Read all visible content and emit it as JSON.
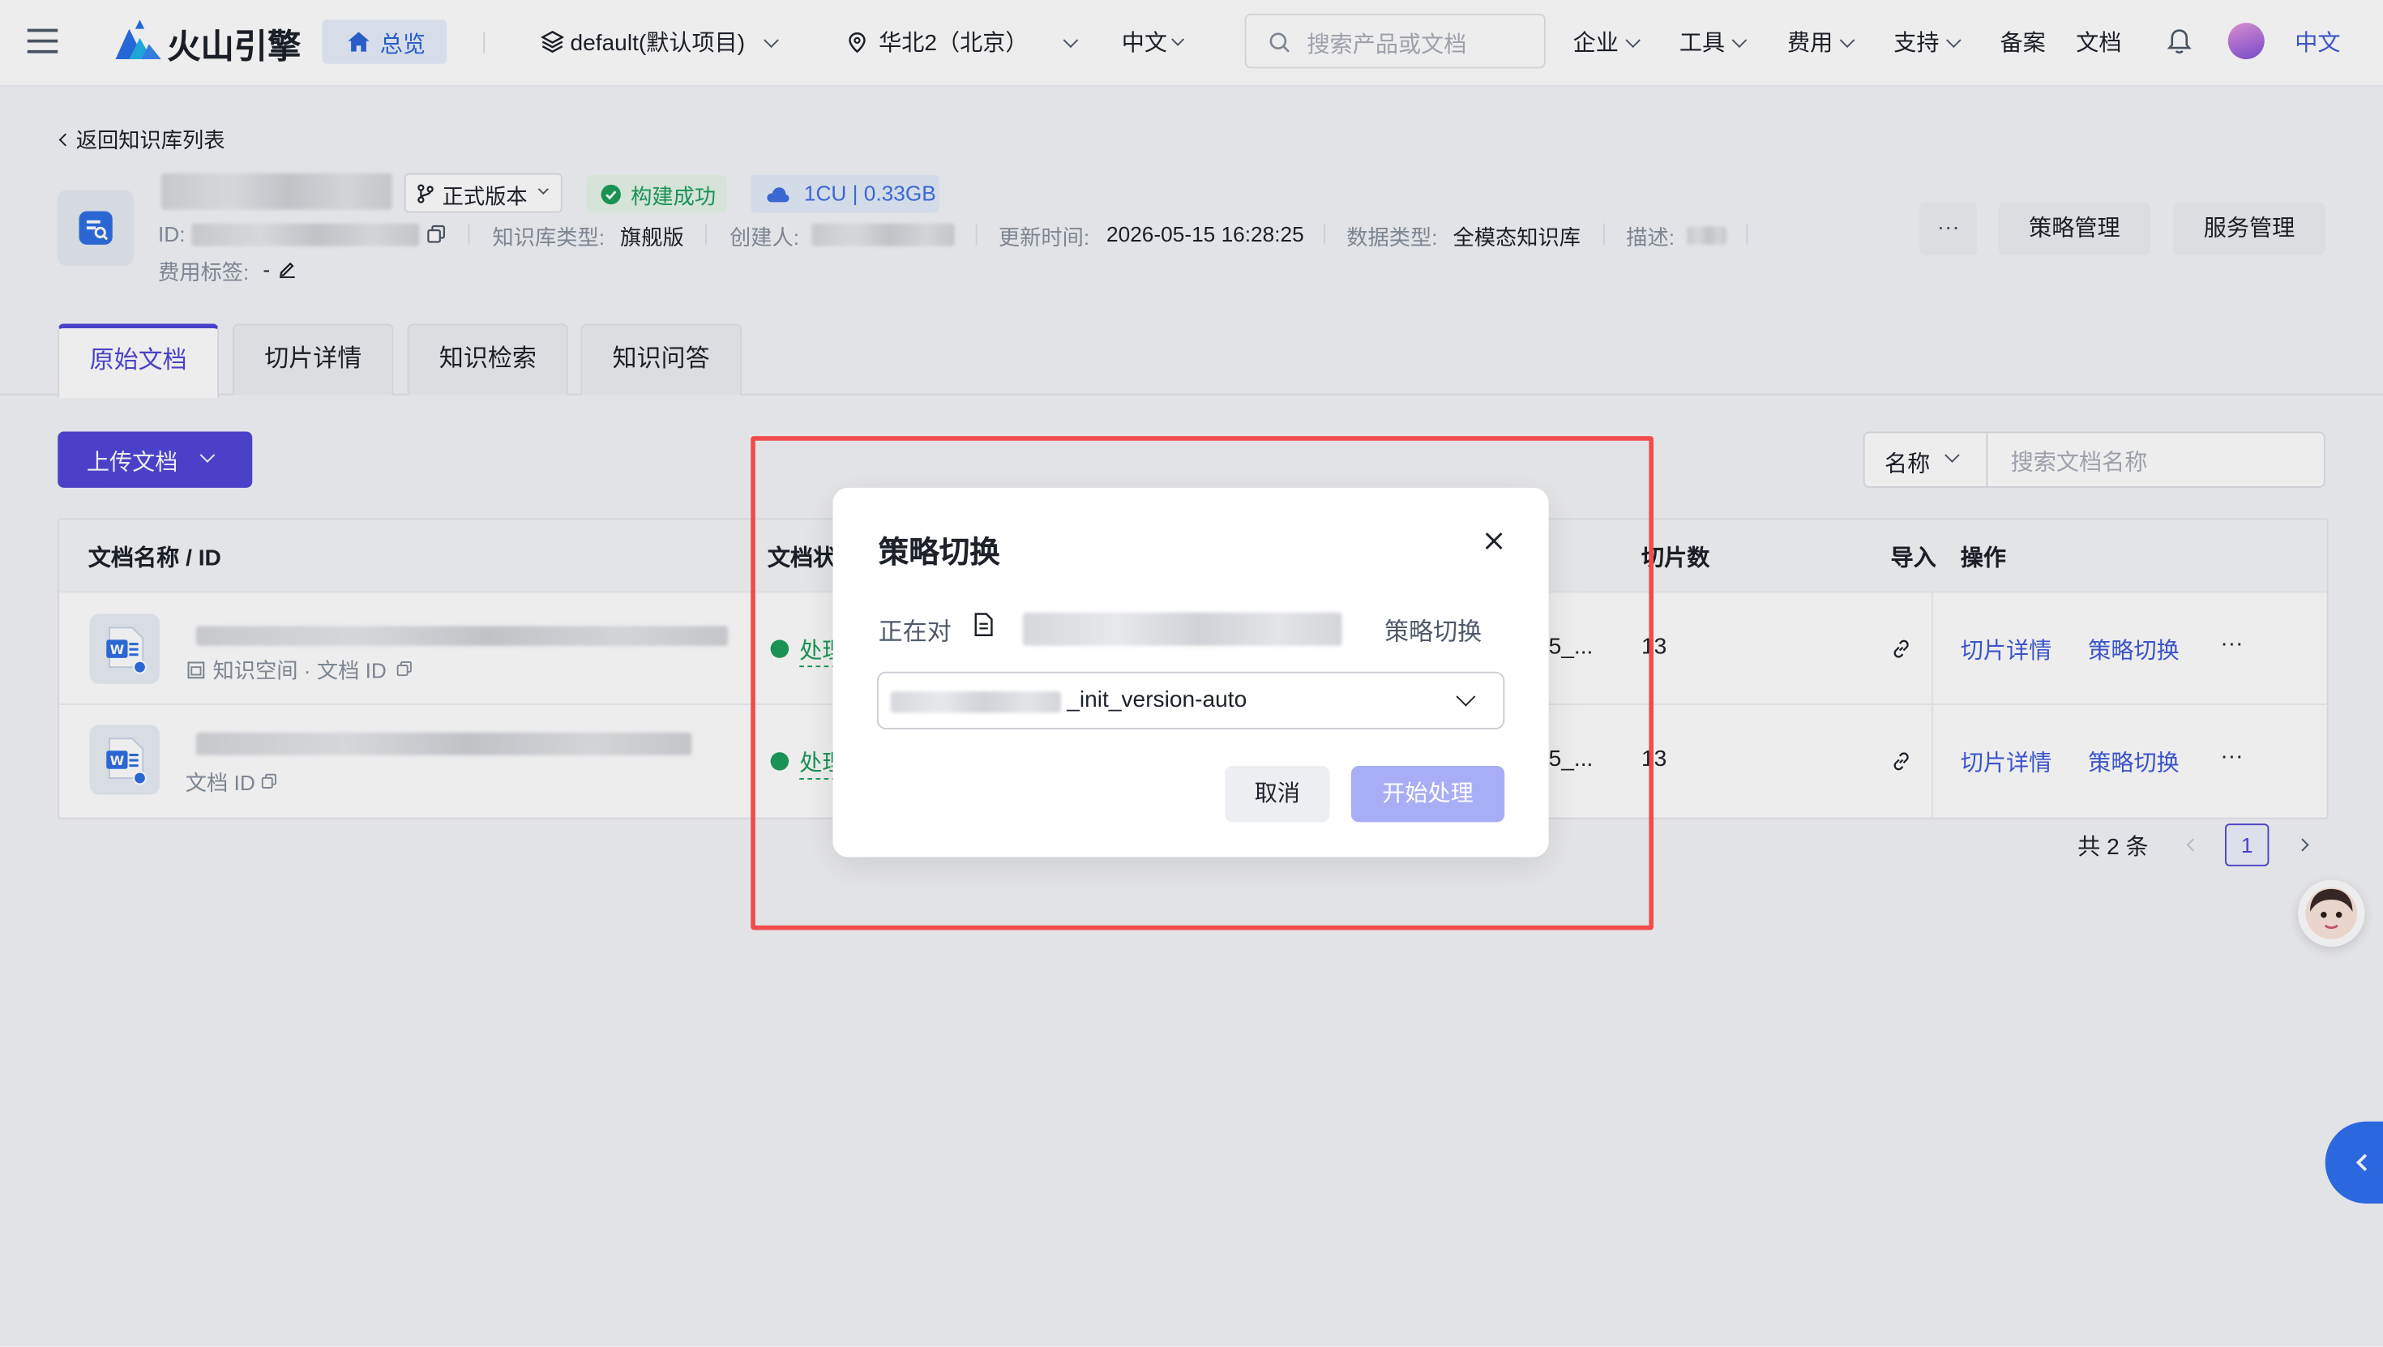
{
  "topbar": {
    "brand": "火山引擎",
    "overview": "总览",
    "project": "default(默认项目)",
    "region": "华北2（北京）",
    "language": "中文",
    "search_placeholder": "搜索产品或文档",
    "menu": [
      "企业",
      "工具",
      "费用",
      "支持"
    ],
    "links": [
      "备案",
      "文档"
    ],
    "lang_short": "中文"
  },
  "kb": {
    "back": "返回知识库列表",
    "version": "正式版本",
    "status": "构建成功",
    "resource": "1CU | 0.33GB",
    "meta": {
      "id_label": "ID:",
      "type_label": "知识库类型:",
      "type_value": "旗舰版",
      "creator_label": "创建人:",
      "updated_label": "更新时间:",
      "updated_value": "2026-05-15 16:28:25",
      "datatype_label": "数据类型:",
      "datatype_value": "全模态知识库",
      "desc_label": "描述:",
      "fee_label": "费用标签:",
      "fee_value": "-"
    },
    "more": "···",
    "strategy_btn": "策略管理",
    "service_btn": "服务管理"
  },
  "tabs": [
    "原始文档",
    "切片详情",
    "知识检索",
    "知识问答"
  ],
  "toolbar": {
    "upload": "上传文档",
    "filter_field": "名称",
    "search_placeholder": "搜索文档名称"
  },
  "table": {
    "headers": [
      "文档名称 / ID",
      "文档状",
      "切片数",
      "导入",
      "操作"
    ],
    "rows": [
      {
        "sub": "知识空间 · 文档 ID",
        "status": "处理",
        "strategy": "5_...",
        "chunks": "13",
        "act1": "切片详情",
        "act2": "策略切换",
        "more": "···"
      },
      {
        "sub": "文档 ID",
        "status": "处理",
        "strategy": "5_...",
        "chunks": "13",
        "act1": "切片详情",
        "act2": "策略切换",
        "more": "···"
      }
    ]
  },
  "pagination": {
    "total": "共 2 条",
    "page": "1"
  },
  "modal": {
    "title": "策略切换",
    "prefix": "正在对",
    "suffix": "策略切换",
    "select_value": "_init_version-auto",
    "cancel": "取消",
    "confirm": "开始处理"
  },
  "colors": {
    "primary": "#5046d8",
    "link": "#3f5bd8",
    "highlight": "#f14b4b",
    "success": "#1d9e5b"
  }
}
